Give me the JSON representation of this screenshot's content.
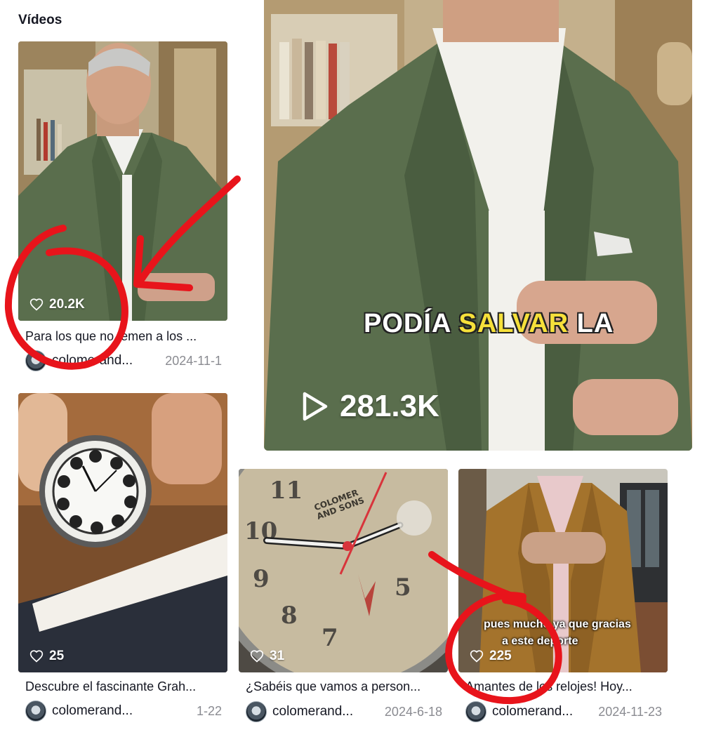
{
  "section": {
    "title": "Vídeos"
  },
  "featured": {
    "views": "281.3K",
    "caption_white_1": "PODÍA",
    "caption_highlight": "SALVAR",
    "caption_white_2": "LA"
  },
  "videos": [
    {
      "likes": "20.2K",
      "description": "Para los que no temen a los ...",
      "author": "colomerand...",
      "date": "2024-11-1"
    },
    {
      "likes": "25",
      "description": "Descubre el fascinante Grah...",
      "author": "colomerand...",
      "date": "1-22"
    },
    {
      "likes": "31",
      "description": "¿Sabéis que vamos a person...",
      "author": "colomerand...",
      "date": "2024-6-18",
      "watch_brand_line1": "COLOMER",
      "watch_brand_line2": "AND SONS"
    },
    {
      "likes": "225",
      "description": "Amantes de los relojes! Hoy...",
      "author": "colomerand...",
      "date": "2024-11-23",
      "subtitle_line1": "pues mucho ya que gracias",
      "subtitle_line2": "a este deporte"
    }
  ],
  "colors": {
    "annotation_red": "#e8141b",
    "blazer_green": "#5a6e4d",
    "blazer_tan": "#a4732c",
    "caption_yellow": "#f6e03a"
  },
  "icons": [
    "heart-icon",
    "play-icon",
    "avatar-logo-icon"
  ]
}
